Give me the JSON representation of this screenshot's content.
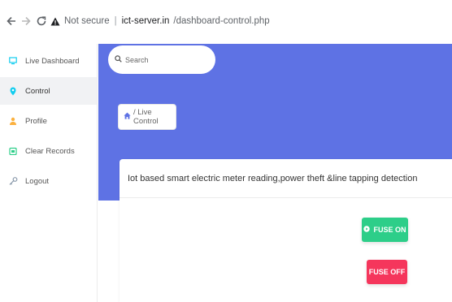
{
  "browser": {
    "not_secure": "Not secure",
    "url_host": "ict-server.in",
    "url_path": "/dashboard-control.php"
  },
  "sidebar": {
    "items": [
      {
        "label": "Live Dashboard",
        "icon": "monitor-icon",
        "color": "#11cdef"
      },
      {
        "label": "Control",
        "icon": "map-pin-icon",
        "color": "#11cdef",
        "active": true
      },
      {
        "label": "Profile",
        "icon": "user-icon",
        "color": "#fbb140"
      },
      {
        "label": "Clear Records",
        "icon": "calendar-icon",
        "color": "#2dce89"
      },
      {
        "label": "Logout",
        "icon": "key-icon",
        "color": "#8898aa"
      }
    ]
  },
  "search": {
    "placeholder": "Search"
  },
  "breadcrumb": {
    "label": "/ Live Control"
  },
  "card": {
    "title": "Iot based smart electric meter reading,power theft &line tapping detection",
    "fuse_on": "FUSE ON",
    "fuse_off": "FUSE OFF"
  },
  "colors": {
    "header": "#5e72e4",
    "fuse_on": "#2dce89",
    "fuse_off": "#f5365c"
  }
}
